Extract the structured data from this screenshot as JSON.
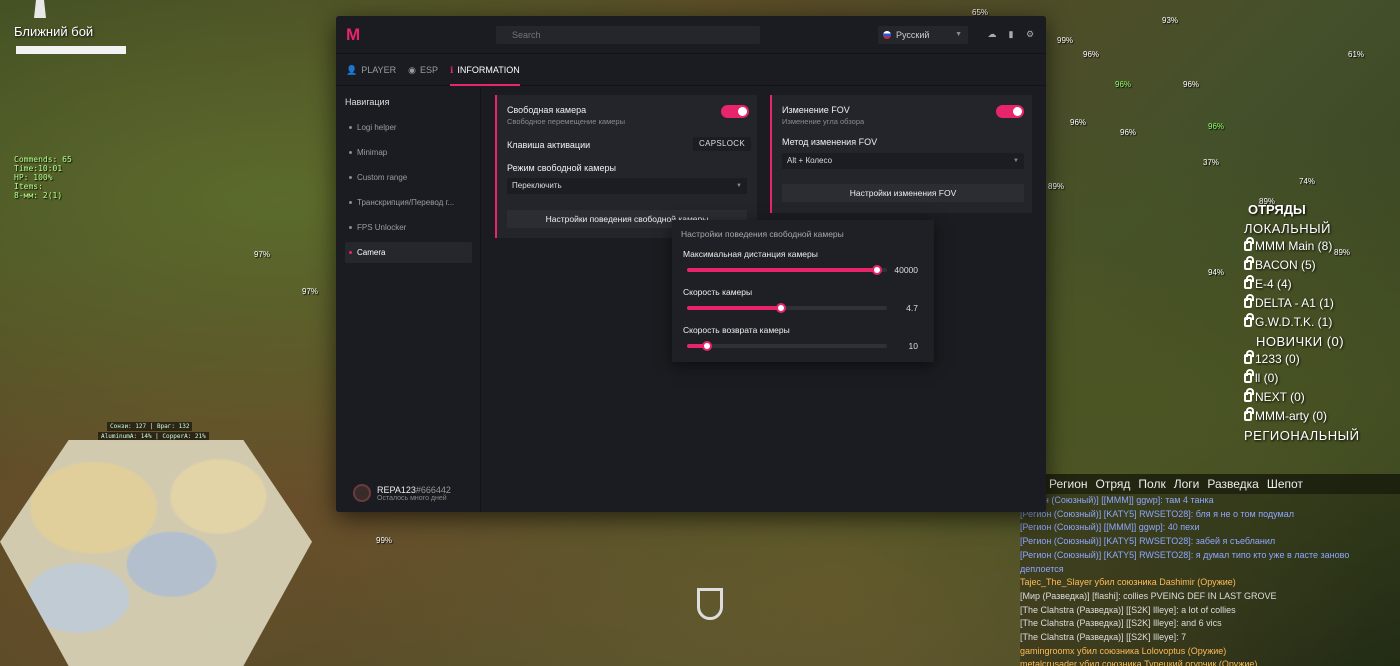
{
  "hud": {
    "melee_label": "Ближний бой",
    "stats": [
      "Commends: 65",
      "Time:10:01",
      "HP: 100%",
      "Items:",
      "8-мм: 2(1)"
    ],
    "res1": "Сонзи: 127 | Враг: 132",
    "res2": "AluminumA: 14% | CopperA: 21%",
    "percents": [
      "97%",
      "97%",
      "99%",
      "65%",
      "93%",
      "96%",
      "96%",
      "96%",
      "99%",
      "96%",
      "96%",
      "96%",
      "37%",
      "89%",
      "74%",
      "89%",
      "94%",
      "89%",
      "61%"
    ]
  },
  "squads": {
    "title": "ОТРЯДЫ",
    "local": "ЛОКАЛЬНЫЙ",
    "local_items": [
      "MMM Main (8)",
      "BACON (5)",
      "E-4 (4)",
      "DELTA - A1 (1)",
      "G.W.D.T.K. (1)"
    ],
    "newbies": "НОВИЧКИ (0)",
    "newbie_items": [
      "1233 (0)",
      "ll (0)",
      "NEXT (0)",
      "MMM-arty (0)"
    ],
    "regional": "РЕГИОНАЛЬНЫЙ"
  },
  "chat": {
    "tabs": [
      "Регион",
      "Отряд",
      "Полк",
      "Логи",
      "Разведка",
      "Шепот"
    ],
    "lines": [
      {
        "t": "Регион (Союзный)] [[MMM]] ggwp]: там 4 танка",
        "c": ""
      },
      {
        "t": "[Регион (Союзный)] [KATY5] RWSETO28]: бля я не о том подумал",
        "c": ""
      },
      {
        "t": "[Регион (Союзный)] [[MMM]] ggwp]: 40 пехи",
        "c": ""
      },
      {
        "t": "[Регион (Союзный)] [KATY5] RWSETO28]: забей я съебланил",
        "c": ""
      },
      {
        "t": "[Регион (Союзный)] [KATY5] RWSETO28]: я думал типо кто уже в ласте заново",
        "c": ""
      },
      {
        "t": "деплоется",
        "c": ""
      },
      {
        "t": "Tajec_The_Slayer убил союзника Dashimir (Оружие)",
        "c": "kill"
      },
      {
        "t": "[Мир (Разведка)] [flashi]: collies PVEING DEF IN LAST GROVE",
        "c": "w"
      },
      {
        "t": "[The Clahstra (Разведка)] [[S2K] llleye]: a lot of collies",
        "c": "w"
      },
      {
        "t": "[The Clahstra (Разведка)] [[S2K] llleye]: and 6 vics",
        "c": "w"
      },
      {
        "t": "[The Clahstra (Разведка)] [[S2K] llleye]: 7",
        "c": "w"
      },
      {
        "t": "gamingroomx убил союзника Lolovoptus (Оружие)",
        "c": "kill"
      },
      {
        "t": "metalcrusader убил союзника Турецкий огурчик (Оружие)",
        "c": "kill"
      }
    ]
  },
  "menu": {
    "search_placeholder": "Search",
    "language": "Русский",
    "tabs": [
      "PLAYER",
      "ESP",
      "INFORMATION"
    ],
    "nav_title": "Навигация",
    "nav_items": [
      "Logi helper",
      "Minimap",
      "Custom range",
      "Транскрипция/Перевод г...",
      "FPS Unlocker",
      "Camera"
    ],
    "user": {
      "name": "REPA123",
      "tag": "#666442",
      "sub": "Осталось много дней"
    },
    "free_cam": {
      "title": "Свободная камера",
      "subtitle": "Свободное перемещение камеры",
      "enabled": true,
      "key_label": "Клавиша активации",
      "key_value": "CAPSLOCK",
      "mode_label": "Режим свободной камеры",
      "mode_value": "Переключить",
      "settings_button": "Настройки поведения свободной камеры"
    },
    "fov": {
      "title": "Изменение FOV",
      "subtitle": "Изменение угла обзора",
      "enabled": true,
      "method_label": "Метод изменения FOV",
      "method_value": "Alt + Колесо",
      "settings_button": "Настройки изменения FOV"
    },
    "popup": {
      "title": "Настройки поведения свободной камеры",
      "sliders": [
        {
          "label": "Максимальная дистанция камеры",
          "value": "40000",
          "fraction": 0.95
        },
        {
          "label": "Скорость камеры",
          "value": "4.7",
          "fraction": 0.47
        },
        {
          "label": "Скорость возврата камеры",
          "value": "10",
          "fraction": 0.1
        }
      ]
    }
  },
  "colors": {
    "accent": "#e8246a",
    "panel": "#1b1c21",
    "card": "#23252b"
  }
}
